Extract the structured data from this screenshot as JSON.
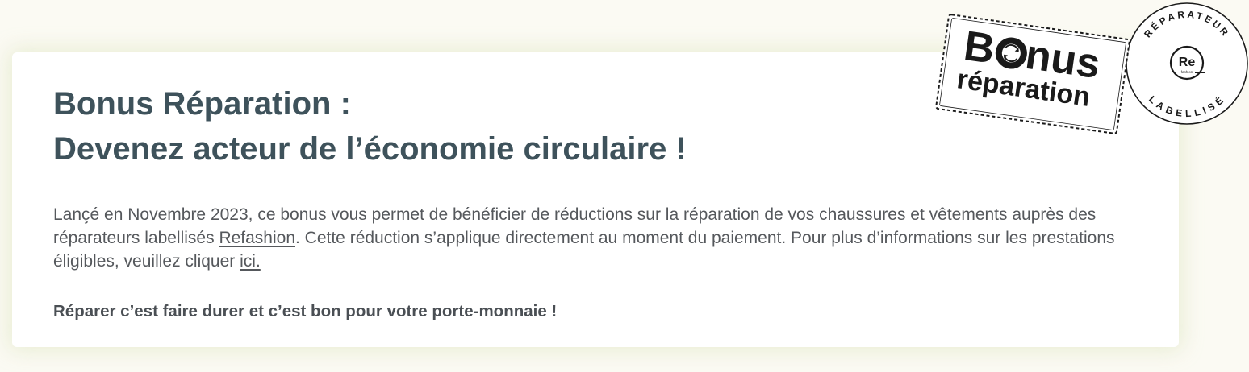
{
  "header": {
    "title_line1": "Bonus Réparation :",
    "title_line2": "Devenez acteur de l’économie circulaire !"
  },
  "body": {
    "text_before_link": "Lançé en Novembre 2023, ce bonus vous permet de bénéficier de réductions sur la réparation de vos chaussures et vêtements auprès des réparateurs labellisés ",
    "refashion_link": "Refashion",
    "text_middle": ". Cette réduction s’applique directement au moment du paiement. Pour plus d’informations sur les prestations éligibles, veuillez cliquer  ",
    "ici_link": "ici.",
    "tagline": "Réparer c’est faire durer et c’est bon pour votre porte-monnaie !"
  },
  "badges": {
    "stamp_line1_before": "B",
    "stamp_line1_after": "nus",
    "stamp_line2": "réparation",
    "seal_top": "RÉPARATEUR",
    "seal_bottom": "LABELLISÉ",
    "seal_logo": "Re",
    "seal_logo_sub": "fashion"
  },
  "colors": {
    "page_background": "#fbfaf3",
    "title": "#3e525b",
    "body_text": "#55585c",
    "badge_ink": "#1a1a1a"
  }
}
